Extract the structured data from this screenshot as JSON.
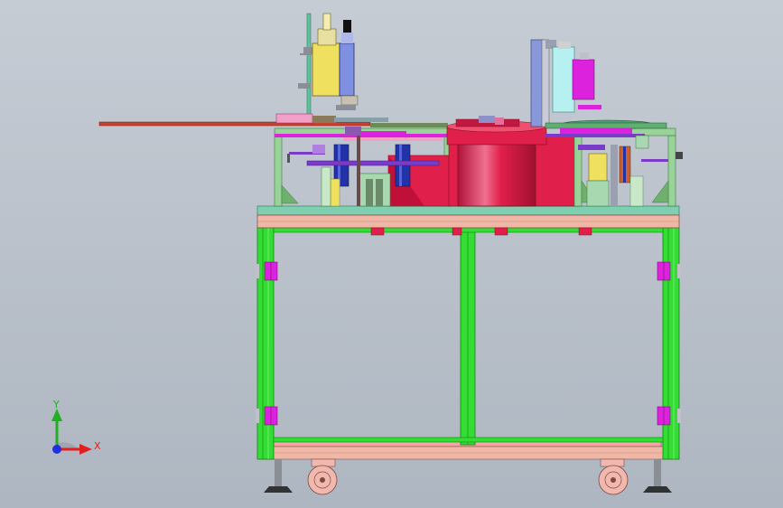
{
  "viewport": {
    "background_top": "#c6ccd4",
    "background_bottom": "#aeb6c1"
  },
  "triad": {
    "x_label": "X",
    "y_label": "Y",
    "x_color": "#e02020",
    "y_color": "#20b020",
    "z_color": "#2030e0"
  },
  "colors": {
    "frame_green": "#33dd33",
    "frame_green_dark": "#118811",
    "deck_top": "#7fcfb0",
    "deck_pink": "#f0b7a6",
    "rail_pink": "#f5a5a8",
    "bowl_red": "#e0204a",
    "bowl_red_dark": "#a81030",
    "pillar_green": "#9ad39a",
    "cylinder_yellow": "#f0e060",
    "cylinder_blue": "#8090e0",
    "magenta": "#dd22dd",
    "navy": "#2233aa",
    "rod": "#c84030",
    "caster": "#f2b8ae",
    "steel": "#8a8f96",
    "cyan_block": "#b6f0f0"
  }
}
